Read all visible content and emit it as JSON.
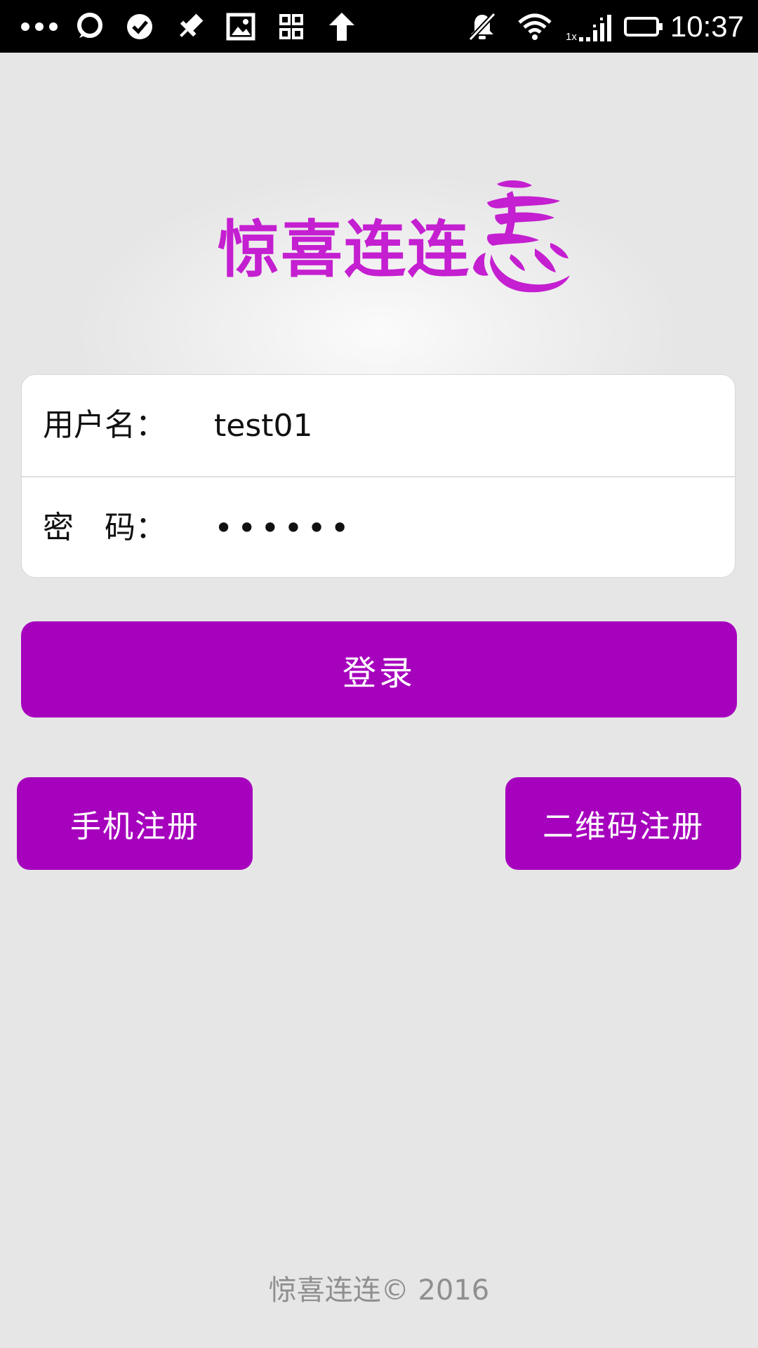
{
  "status_bar": {
    "time": "10:37",
    "notification_icons": [
      "more-dots-icon",
      "chat-bubble-icon",
      "check-circle-icon",
      "pin-icon",
      "image-icon",
      "grid-icon",
      "upload-arrow-icon"
    ],
    "system_icons": [
      "mute-bell-icon",
      "wifi-icon",
      "signal-icon",
      "battery-icon"
    ],
    "signal_badge": "1x"
  },
  "logo": {
    "text": "惊喜连连",
    "mark_icon": "calligraphy-hui-icon",
    "color": "#c41fd0"
  },
  "login_form": {
    "username_label": "用户名：",
    "username_value": "test01",
    "password_label": "密　码：",
    "password_value": "••••••"
  },
  "buttons": {
    "login": "登录",
    "phone_register": "手机注册",
    "qr_register": "二维码注册",
    "accent_color": "#a602bd"
  },
  "footer": {
    "copyright": "惊喜连连© 2016"
  }
}
